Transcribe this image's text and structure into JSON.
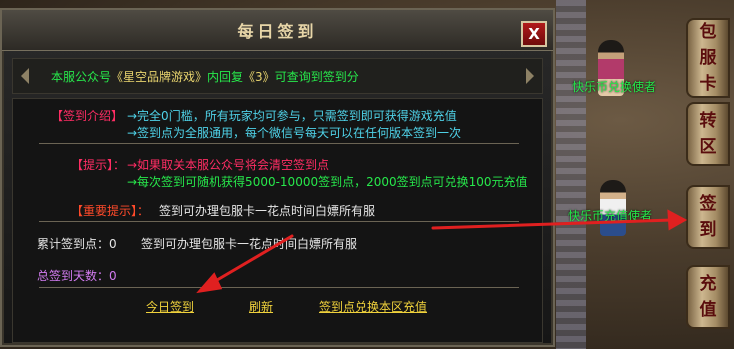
{
  "window": {
    "title": "每日签到",
    "close_label": "X"
  },
  "notice": {
    "prefix": "本服公众号",
    "account": "《星空品牌游戏》",
    "middle": "内回复",
    "code": "《3》",
    "suffix": "可查询到签到分"
  },
  "intro": {
    "tag": "【签到介绍】",
    "line1": "→完全0门槛，所有玩家均可参与，只需签到即可获得游戏充值",
    "line2": "→签到点为全服通用，每个微信号每天可以在任何版本签到一次"
  },
  "tips": {
    "tag": "【提示】：",
    "line1": "→如果取关本服公众号将会清空签到点",
    "line2": "→每次签到可随机获得5000-10000签到点，2000签到点可兑换100元充值"
  },
  "important": {
    "tag": "【重要提示】：",
    "text": "签到可办理包服卡一花点时间白嫖所有服"
  },
  "stats": {
    "points_label": "累计签到点：0",
    "points_text": "签到可办理包服卡一花点时间白嫖所有服",
    "days_label": "总签到天数：0"
  },
  "actions": {
    "checkin": "今日签到",
    "refresh": "刷新",
    "exchange": "签到点兑换本区充值"
  },
  "npcs": {
    "npc1": "快乐币兑换使者",
    "npc2": "快乐币充值使者"
  },
  "side_tabs": {
    "tab1": [
      "包",
      "服",
      "卡"
    ],
    "tab2": [
      "转",
      "区"
    ],
    "tab3": [
      "签",
      "到"
    ],
    "tab4": [
      "充",
      "值"
    ]
  },
  "colors": {
    "accent_green": "#27e84b",
    "accent_red": "#ff2d64",
    "link_yellow": "#f0d23c",
    "annotation_red": "#e02020"
  }
}
